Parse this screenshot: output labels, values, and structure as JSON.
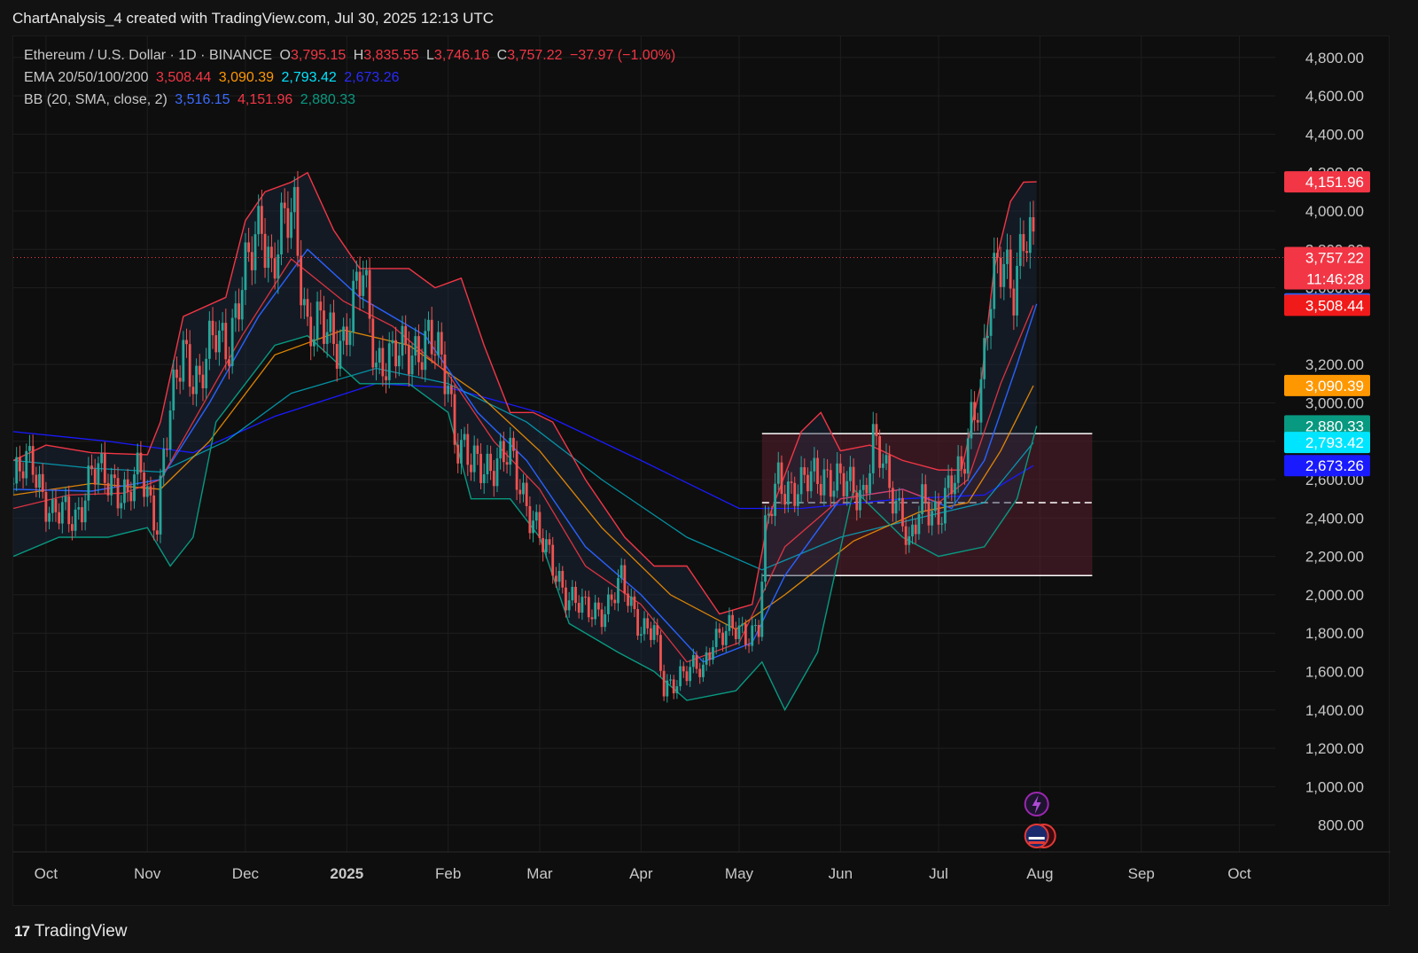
{
  "header": {
    "title": "ChartAnalysis_4 created with TradingView.com, Jul 30, 2025 12:13 UTC"
  },
  "legend": {
    "symbol": "Ethereum / U.S. Dollar · 1D · BINANCE",
    "o_label": "O",
    "o_value": "3,795.15",
    "h_label": "H",
    "h_value": "3,835.55",
    "l_label": "L",
    "l_value": "3,746.16",
    "c_label": "C",
    "c_value": "3,757.22",
    "change": "−37.97 (−1.00%)",
    "ema_label": "EMA 20/50/100/200",
    "ema20": "3,508.44",
    "ema50": "3,090.39",
    "ema100": "2,793.42",
    "ema200": "2,673.26",
    "bb_label": "BB (20, SMA, close, 2)",
    "bb_basis": "3,516.15",
    "bb_upper": "4,151.96",
    "bb_lower": "2,880.33"
  },
  "footer": {
    "brand": "TradingView"
  },
  "colors": {
    "up": "#26a69a",
    "down": "#ef5350",
    "ema20": "#f23645",
    "ema50": "#ff9800",
    "ema100": "#00bcd4",
    "ema200": "#1a1aff",
    "bb_upper": "#f23645",
    "bb_basis": "#2962ff",
    "bb_lower": "#089981",
    "range_box": "#5a1f2e"
  },
  "chart_data": {
    "type": "candlestick",
    "y_ticks": [
      "4,800.00",
      "4,600.00",
      "4,400.00",
      "4,200.00",
      "4,000.00",
      "3,800.00",
      "3,600.00",
      "3,200.00",
      "3,000.00",
      "2,800.00",
      "2,600.00",
      "2,400.00",
      "2,200.00",
      "2,000.00",
      "1,800.00",
      "1,600.00",
      "1,400.00",
      "1,200.00",
      "1,000.00",
      "800.00"
    ],
    "y_tick_values": [
      4800,
      4600,
      4400,
      4200,
      4000,
      3800,
      3600,
      3200,
      3000,
      2800,
      2600,
      2400,
      2200,
      2000,
      1800,
      1600,
      1400,
      1200,
      1000,
      800
    ],
    "ylim": [
      660,
      4910
    ],
    "x_ticks": [
      {
        "label": "Oct",
        "date": "2024-10-01"
      },
      {
        "label": "Nov",
        "date": "2024-11-01"
      },
      {
        "label": "Dec",
        "date": "2024-12-01"
      },
      {
        "label": "2025",
        "date": "2025-01-01",
        "bold": true
      },
      {
        "label": "Feb",
        "date": "2025-02-01"
      },
      {
        "label": "Mar",
        "date": "2025-03-01"
      },
      {
        "label": "Apr",
        "date": "2025-04-01"
      },
      {
        "label": "May",
        "date": "2025-05-01"
      },
      {
        "label": "Jun",
        "date": "2025-06-01"
      },
      {
        "label": "Jul",
        "date": "2025-07-01"
      },
      {
        "label": "Aug",
        "date": "2025-08-01"
      },
      {
        "label": "Sep",
        "date": "2025-09-01"
      },
      {
        "label": "Oct",
        "date": "2025-10-01"
      }
    ],
    "x_range": [
      "2024-09-21",
      "2025-10-12"
    ],
    "price_labels": [
      {
        "value": 4151.96,
        "text": "4,151.96",
        "color": "#f23645"
      },
      {
        "value": 3757.22,
        "text": "3,757.22",
        "sub": "11:46:28",
        "color": "#f23645"
      },
      {
        "value": 3516.15,
        "text": "3,516.15",
        "color": "#2962ff"
      },
      {
        "value": 3508.44,
        "text": "3,508.44",
        "color": "#f01a1a"
      },
      {
        "value": 3090.39,
        "text": "3,090.39",
        "color": "#ff9800"
      },
      {
        "value": 2880.33,
        "text": "2,880.33",
        "color": "#089981"
      },
      {
        "value": 2793.42,
        "text": "2,793.42",
        "color": "#00e5ff"
      },
      {
        "value": 2673.26,
        "text": "2,673.26",
        "color": "#1a1aff"
      }
    ],
    "current_price": 3757.22,
    "range_box": {
      "start": "2025-05-08",
      "end": "2025-08-17",
      "top": 2840,
      "bottom": 2100,
      "mid": 2480
    },
    "close_path": [
      [
        "2024-09-21",
        2580
      ],
      [
        "2024-09-27",
        2700
      ],
      [
        "2024-10-03",
        2400
      ],
      [
        "2024-10-10",
        2420
      ],
      [
        "2024-10-15",
        2620
      ],
      [
        "2024-10-22",
        2600
      ],
      [
        "2024-10-26",
        2500
      ],
      [
        "2024-10-30",
        2640
      ],
      [
        "2024-11-04",
        2400
      ],
      [
        "2024-11-06",
        2720
      ],
      [
        "2024-11-12",
        3300
      ],
      [
        "2024-11-17",
        3100
      ],
      [
        "2024-11-22",
        3350
      ],
      [
        "2024-11-26",
        3350
      ],
      [
        "2024-12-02",
        3700
      ],
      [
        "2024-12-06",
        4000
      ],
      [
        "2024-12-09",
        3700
      ],
      [
        "2024-12-13",
        3900
      ],
      [
        "2024-12-16",
        4000
      ],
      [
        "2024-12-20",
        3400
      ],
      [
        "2024-12-26",
        3350
      ],
      [
        "2024-12-31",
        3350
      ],
      [
        "2025-01-06",
        3650
      ],
      [
        "2025-01-10",
        3250
      ],
      [
        "2025-01-15",
        3200
      ],
      [
        "2025-01-20",
        3300
      ],
      [
        "2025-01-26",
        3300
      ],
      [
        "2025-02-01",
        3150
      ],
      [
        "2025-02-03",
        2850
      ],
      [
        "2025-02-08",
        2650
      ],
      [
        "2025-02-14",
        2700
      ],
      [
        "2025-02-20",
        2700
      ],
      [
        "2025-02-25",
        2500
      ],
      [
        "2025-03-03",
        2200
      ],
      [
        "2025-03-10",
        2000
      ],
      [
        "2025-03-15",
        1900
      ],
      [
        "2025-03-22",
        1950
      ],
      [
        "2025-03-26",
        2050
      ],
      [
        "2025-04-01",
        1850
      ],
      [
        "2025-04-05",
        1800
      ],
      [
        "2025-04-08",
        1500
      ],
      [
        "2025-04-13",
        1600
      ],
      [
        "2025-04-20",
        1600
      ],
      [
        "2025-04-23",
        1800
      ],
      [
        "2025-04-28",
        1800
      ],
      [
        "2025-05-03",
        1800
      ],
      [
        "2025-05-07",
        1850
      ],
      [
        "2025-05-09",
        2300
      ],
      [
        "2025-05-13",
        2600
      ],
      [
        "2025-05-20",
        2550
      ],
      [
        "2025-05-27",
        2650
      ],
      [
        "2025-06-02",
        2550
      ],
      [
        "2025-06-08",
        2550
      ],
      [
        "2025-06-11",
        2800
      ],
      [
        "2025-06-16",
        2550
      ],
      [
        "2025-06-20",
        2450
      ],
      [
        "2025-06-22",
        2250
      ],
      [
        "2025-06-26",
        2450
      ],
      [
        "2025-07-01",
        2450
      ],
      [
        "2025-07-04",
        2550
      ],
      [
        "2025-07-08",
        2600
      ],
      [
        "2025-07-11",
        2950
      ],
      [
        "2025-07-14",
        3100
      ],
      [
        "2025-07-16",
        3400
      ],
      [
        "2025-07-18",
        3600
      ],
      [
        "2025-07-21",
        3750
      ],
      [
        "2025-07-24",
        3650
      ],
      [
        "2025-07-27",
        3850
      ],
      [
        "2025-07-30",
        3757
      ]
    ],
    "ema20": [
      [
        "2024-09-21",
        2450
      ],
      [
        "2024-10-08",
        2520
      ],
      [
        "2024-10-25",
        2530
      ],
      [
        "2024-11-05",
        2600
      ],
      [
        "2024-11-15",
        2900
      ],
      [
        "2024-11-30",
        3350
      ],
      [
        "2024-12-15",
        3750
      ],
      [
        "2024-12-31",
        3530
      ],
      [
        "2025-01-15",
        3400
      ],
      [
        "2025-02-01",
        3150
      ],
      [
        "2025-02-15",
        2800
      ],
      [
        "2025-03-01",
        2550
      ],
      [
        "2025-03-15",
        2150
      ],
      [
        "2025-04-01",
        1950
      ],
      [
        "2025-04-15",
        1650
      ],
      [
        "2025-05-01",
        1750
      ],
      [
        "2025-05-15",
        2250
      ],
      [
        "2025-06-01",
        2500
      ],
      [
        "2025-06-20",
        2550
      ],
      [
        "2025-07-01",
        2480
      ],
      [
        "2025-07-10",
        2600
      ],
      [
        "2025-07-20",
        3100
      ],
      [
        "2025-07-30",
        3508
      ]
    ],
    "ema50": [
      [
        "2024-09-21",
        2520
      ],
      [
        "2024-10-15",
        2580
      ],
      [
        "2024-11-05",
        2550
      ],
      [
        "2024-11-20",
        2800
      ],
      [
        "2024-12-10",
        3250
      ],
      [
        "2024-12-31",
        3380
      ],
      [
        "2025-01-20",
        3300
      ],
      [
        "2025-02-10",
        3050
      ],
      [
        "2025-03-01",
        2750
      ],
      [
        "2025-03-20",
        2350
      ],
      [
        "2025-04-10",
        2000
      ],
      [
        "2025-04-30",
        1820
      ],
      [
        "2025-05-15",
        2000
      ],
      [
        "2025-06-05",
        2280
      ],
      [
        "2025-06-25",
        2430
      ],
      [
        "2025-07-10",
        2480
      ],
      [
        "2025-07-20",
        2750
      ],
      [
        "2025-07-30",
        3090
      ]
    ],
    "ema100": [
      [
        "2024-09-21",
        2700
      ],
      [
        "2024-10-15",
        2660
      ],
      [
        "2024-11-05",
        2640
      ],
      [
        "2024-11-25",
        2800
      ],
      [
        "2024-12-15",
        3050
      ],
      [
        "2025-01-10",
        3180
      ],
      [
        "2025-02-01",
        3100
      ],
      [
        "2025-02-25",
        2900
      ],
      [
        "2025-03-20",
        2600
      ],
      [
        "2025-04-15",
        2300
      ],
      [
        "2025-05-08",
        2130
      ],
      [
        "2025-06-01",
        2300
      ],
      [
        "2025-06-25",
        2400
      ],
      [
        "2025-07-15",
        2480
      ],
      [
        "2025-07-30",
        2793
      ]
    ],
    "ema200": [
      [
        "2024-09-21",
        2850
      ],
      [
        "2024-10-20",
        2800
      ],
      [
        "2024-11-15",
        2740
      ],
      [
        "2024-12-10",
        2930
      ],
      [
        "2025-01-10",
        3100
      ],
      [
        "2025-02-01",
        3080
      ],
      [
        "2025-03-01",
        2950
      ],
      [
        "2025-04-01",
        2700
      ],
      [
        "2025-05-01",
        2450
      ],
      [
        "2025-05-20",
        2450
      ],
      [
        "2025-06-20",
        2500
      ],
      [
        "2025-07-15",
        2520
      ],
      [
        "2025-07-30",
        2673
      ]
    ],
    "bb_upper": [
      [
        "2024-09-21",
        2700
      ],
      [
        "2024-10-01",
        2780
      ],
      [
        "2024-10-15",
        2740
      ],
      [
        "2024-11-01",
        2730
      ],
      [
        "2024-11-05",
        2900
      ],
      [
        "2024-11-12",
        3450
      ],
      [
        "2024-11-25",
        3550
      ],
      [
        "2024-12-01",
        3950
      ],
      [
        "2024-12-07",
        4100
      ],
      [
        "2024-12-15",
        4150
      ],
      [
        "2024-12-20",
        4200
      ],
      [
        "2024-12-28",
        3900
      ],
      [
        "2025-01-05",
        3700
      ],
      [
        "2025-01-20",
        3700
      ],
      [
        "2025-01-28",
        3600
      ],
      [
        "2025-02-05",
        3650
      ],
      [
        "2025-02-12",
        3300
      ],
      [
        "2025-02-20",
        2950
      ],
      [
        "2025-02-27",
        2950
      ],
      [
        "2025-03-05",
        2900
      ],
      [
        "2025-03-15",
        2600
      ],
      [
        "2025-03-27",
        2300
      ],
      [
        "2025-04-05",
        2150
      ],
      [
        "2025-04-15",
        2150
      ],
      [
        "2025-04-25",
        1900
      ],
      [
        "2025-05-05",
        1950
      ],
      [
        "2025-05-10",
        2400
      ],
      [
        "2025-05-20",
        2850
      ],
      [
        "2025-05-26",
        2950
      ],
      [
        "2025-06-01",
        2750
      ],
      [
        "2025-06-10",
        2780
      ],
      [
        "2025-06-20",
        2700
      ],
      [
        "2025-07-01",
        2650
      ],
      [
        "2025-07-08",
        2650
      ],
      [
        "2025-07-14",
        3100
      ],
      [
        "2025-07-18",
        3700
      ],
      [
        "2025-07-23",
        4050
      ],
      [
        "2025-07-27",
        4150
      ],
      [
        "2025-07-31",
        4152
      ]
    ],
    "bb_basis": [
      [
        "2024-09-21",
        2550
      ],
      [
        "2024-10-15",
        2540
      ],
      [
        "2024-11-05",
        2600
      ],
      [
        "2024-11-20",
        3000
      ],
      [
        "2024-12-05",
        3450
      ],
      [
        "2024-12-20",
        3800
      ],
      [
        "2025-01-05",
        3550
      ],
      [
        "2025-01-25",
        3350
      ],
      [
        "2025-02-10",
        2950
      ],
      [
        "2025-02-25",
        2700
      ],
      [
        "2025-03-15",
        2250
      ],
      [
        "2025-04-01",
        2000
      ],
      [
        "2025-04-20",
        1650
      ],
      [
        "2025-05-05",
        1750
      ],
      [
        "2025-05-15",
        2100
      ],
      [
        "2025-06-01",
        2500
      ],
      [
        "2025-06-20",
        2550
      ],
      [
        "2025-07-05",
        2450
      ],
      [
        "2025-07-15",
        2700
      ],
      [
        "2025-07-25",
        3200
      ],
      [
        "2025-07-31",
        3516
      ]
    ],
    "bb_lower": [
      [
        "2024-09-21",
        2200
      ],
      [
        "2024-10-05",
        2300
      ],
      [
        "2024-10-20",
        2300
      ],
      [
        "2024-11-01",
        2350
      ],
      [
        "2024-11-08",
        2150
      ],
      [
        "2024-11-15",
        2300
      ],
      [
        "2024-11-22",
        2900
      ],
      [
        "2024-12-01",
        3100
      ],
      [
        "2024-12-10",
        3300
      ],
      [
        "2024-12-20",
        3350
      ],
      [
        "2025-01-05",
        3100
      ],
      [
        "2025-01-20",
        3100
      ],
      [
        "2025-02-01",
        2950
      ],
      [
        "2025-02-08",
        2500
      ],
      [
        "2025-02-20",
        2500
      ],
      [
        "2025-03-01",
        2300
      ],
      [
        "2025-03-10",
        1850
      ],
      [
        "2025-03-25",
        1700
      ],
      [
        "2025-04-05",
        1600
      ],
      [
        "2025-04-15",
        1450
      ],
      [
        "2025-04-30",
        1500
      ],
      [
        "2025-05-08",
        1650
      ],
      [
        "2025-05-15",
        1400
      ],
      [
        "2025-05-25",
        1700
      ],
      [
        "2025-06-05",
        2550
      ],
      [
        "2025-06-20",
        2300
      ],
      [
        "2025-07-01",
        2200
      ],
      [
        "2025-07-15",
        2250
      ],
      [
        "2025-07-25",
        2500
      ],
      [
        "2025-07-31",
        2880
      ]
    ]
  }
}
